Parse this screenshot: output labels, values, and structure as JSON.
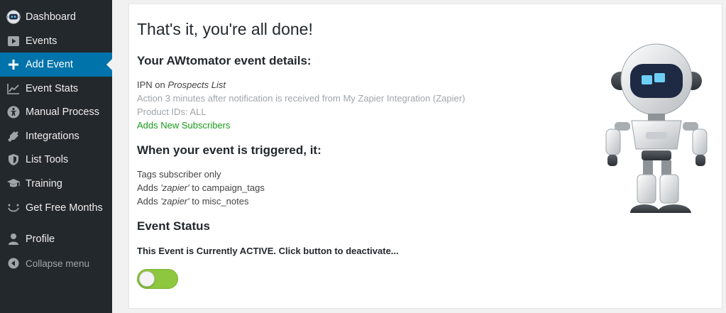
{
  "sidebar": {
    "items": [
      {
        "label": "Dashboard",
        "icon": "robot-avatar-icon"
      },
      {
        "label": "Events",
        "icon": "video-play-icon"
      },
      {
        "label": "Add Event",
        "icon": "plus-icon",
        "active": true
      },
      {
        "label": "Event Stats",
        "icon": "chart-line-icon"
      },
      {
        "label": "Manual Process",
        "icon": "accessibility-icon"
      },
      {
        "label": "Integrations",
        "icon": "plug-icon"
      },
      {
        "label": "List Tools",
        "icon": "shield-icon"
      },
      {
        "label": "Training",
        "icon": "graduation-cap-icon"
      },
      {
        "label": "Get Free Months",
        "icon": "smile-icon"
      },
      {
        "label": "Profile",
        "icon": "user-icon"
      },
      {
        "label": "Collapse menu",
        "icon": "collapse-arrow-icon"
      }
    ],
    "active_color": "#0073aa",
    "background": "#23282d"
  },
  "main": {
    "title": "That's it, you're all done!",
    "details_heading": "Your AWtomator event details:",
    "ipn_prefix": "IPN on ",
    "ipn_list": "Prospects List",
    "action_line": "Action 3 minutes after notification is received from My Zapier Integration (Zapier)",
    "product_ids": "Product IDs: ALL",
    "adds_subscribers": "Adds New Subscribers",
    "trigger_heading": "When your event is triggered, it:",
    "trigger_line1": "Tags subscriber only",
    "adds_word": "Adds ",
    "tag_value": "'zapier'",
    "campaign_tags_suffix": " to campaign_tags",
    "misc_notes_suffix": " to misc_notes",
    "status_heading": "Event Status",
    "status_text": "This Event is Currently ACTIVE. Click button to deactivate...",
    "toggle_on": true,
    "toggle_color": "#8dc63f",
    "illustration": "robot-mascot"
  }
}
